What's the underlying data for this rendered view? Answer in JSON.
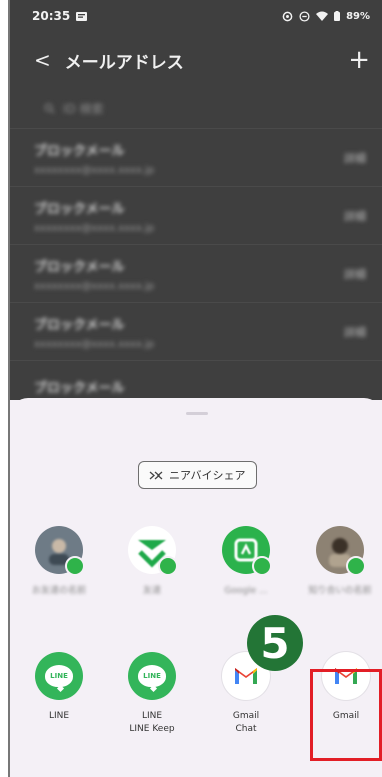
{
  "status_bar": {
    "time": "20:35",
    "battery": "89%"
  },
  "app_header": {
    "back_symbol": "<",
    "title": "メールアドレス",
    "add_symbol": "+"
  },
  "search": {
    "text": "ID 検索"
  },
  "list": [
    {
      "title": "ブロックメール",
      "subtitle": "xxxxxxxx@xxxx.xxxx.jp",
      "action": "詳細"
    },
    {
      "title": "ブロックメール",
      "subtitle": "xxxxxxxx@xxxx.xxxx.jp",
      "action": "詳細"
    },
    {
      "title": "ブロックメール",
      "subtitle": "xxxxxxxx@xxxx.xxxx.jp",
      "action": "詳細"
    },
    {
      "title": "ブロックメール",
      "subtitle": "xxxxxxxx@xxxx.xxxx.jp",
      "action": "詳細"
    },
    {
      "title": "ブロックメール",
      "subtitle": "",
      "action": ""
    }
  ],
  "share_sheet": {
    "nearby_share_label": "ニアバイシェア",
    "contacts": [
      {
        "name": "お友達の名前",
        "color": "#6e7b86"
      },
      {
        "name": "友達",
        "color": "#1fa94a"
      },
      {
        "name": "Google ...",
        "color": "#2bb24c"
      },
      {
        "name": "知り合いの名前",
        "color": "#8d8273"
      }
    ],
    "apps": [
      {
        "name": "LINE",
        "name2": "",
        "icon": "line-icon"
      },
      {
        "name": "LINE",
        "name2": "LINE Keep",
        "icon": "line-icon"
      },
      {
        "name": "Gmail",
        "name2": "Chat",
        "icon": "gmail-icon"
      },
      {
        "name": "Gmail",
        "name2": "",
        "icon": "gmail-icon"
      }
    ]
  },
  "annotation": {
    "step": "5"
  },
  "colors": {
    "line_green": "#33b55a",
    "step_green": "#237536",
    "highlight_red": "#e21e26",
    "sheet_bg": "#f4f0f6"
  }
}
